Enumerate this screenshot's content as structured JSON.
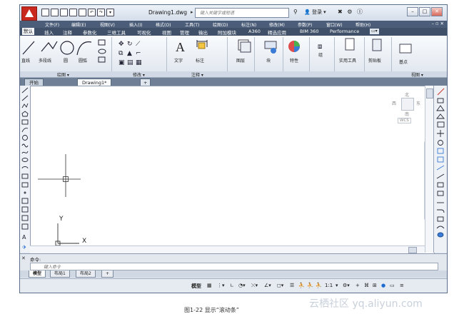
{
  "titlebar": {
    "doc_title": "Drawing1.dwg",
    "search_placeholder": "键入关键字或短语",
    "login_label": "登录",
    "help_label": "?"
  },
  "menu": {
    "items": [
      "文件(F)",
      "编辑(E)",
      "视图(V)",
      "插入(I)",
      "格式(O)",
      "工具(T)",
      "绘图(D)",
      "标注(N)",
      "修改(M)",
      "参数(P)",
      "窗口(W)",
      "帮助(H)"
    ]
  },
  "ribbon_tabs": [
    "默认",
    "插入",
    "注释",
    "参数化",
    "三维工具",
    "可视化",
    "视图",
    "管理",
    "输出",
    "附加模块",
    "A360",
    "精选应用",
    "BIM 360",
    "Performance"
  ],
  "ribbon": {
    "draw": [
      "直线",
      "多段线",
      "圆",
      "圆弧"
    ],
    "text_label": "文字",
    "dim_label": "标注",
    "layer_label": "图层",
    "block_label": "块",
    "prop_label": "特性",
    "group_label": "组",
    "util_label": "实用工具",
    "clip_label": "剪贴板",
    "base_label": "基点"
  },
  "panels": [
    "绘图 ▾",
    "修改 ▾",
    "注释 ▾",
    "视图 ▾"
  ],
  "file_tabs": [
    "开始",
    "Drawing1*",
    "+"
  ],
  "viewcube": {
    "north": "北",
    "east": "东",
    "south": "南",
    "west": "西",
    "wcs": "WCS"
  },
  "axis": {
    "x": "X",
    "y": "Y"
  },
  "command": {
    "prev": "命令:",
    "placeholder": "键入命令"
  },
  "layout_tabs": [
    "模型",
    "布局1",
    "布局2",
    "+"
  ],
  "status": {
    "model": "模型",
    "scale": "1:1"
  },
  "caption": "图1-22 显示“滚动条”",
  "watermark": "云栖社区 yq.aliyun.com"
}
